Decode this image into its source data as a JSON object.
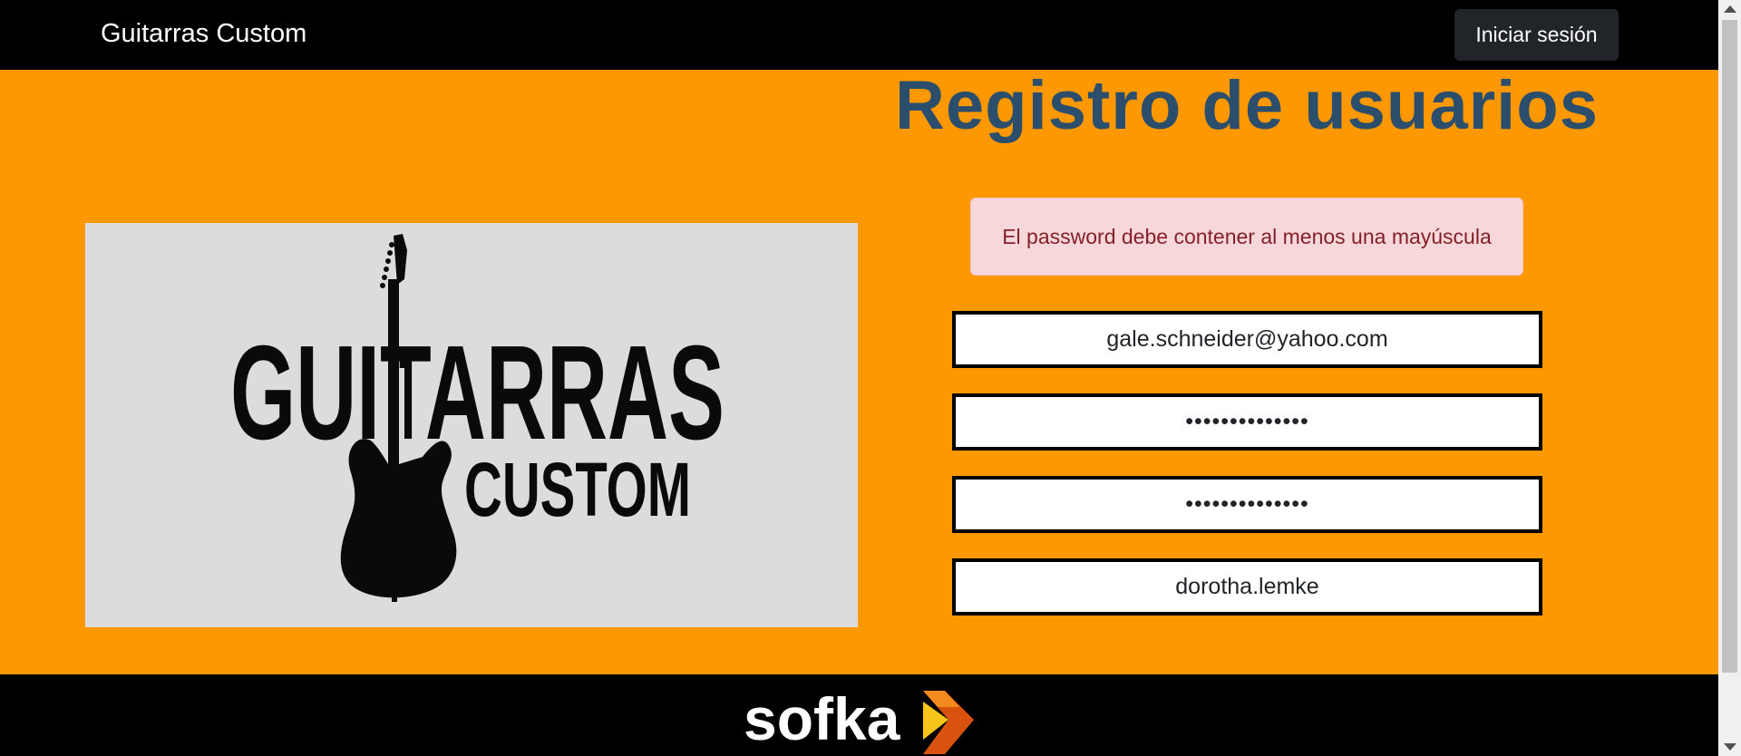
{
  "navbar": {
    "brand": "Guitarras Custom",
    "login_label": "Iniciar sesión"
  },
  "main": {
    "title": "Registro de usuarios",
    "logo": {
      "line1": "GUITARRAS",
      "line2": "CUSTOM"
    },
    "alert": "El password debe contener al menos una mayúscula",
    "form": {
      "email": "gale.schneider@yahoo.com",
      "password": "••••••••••••••",
      "password_confirm": "••••••••••••••",
      "username": "dorotha.lemke"
    }
  },
  "footer": {
    "logo_text": "sofka"
  },
  "colors": {
    "page_bg": "#fd9800",
    "title": "#2c4e6d",
    "alert_bg": "#f8d7da",
    "alert_text": "#842029",
    "navbar_bg": "#000000"
  }
}
